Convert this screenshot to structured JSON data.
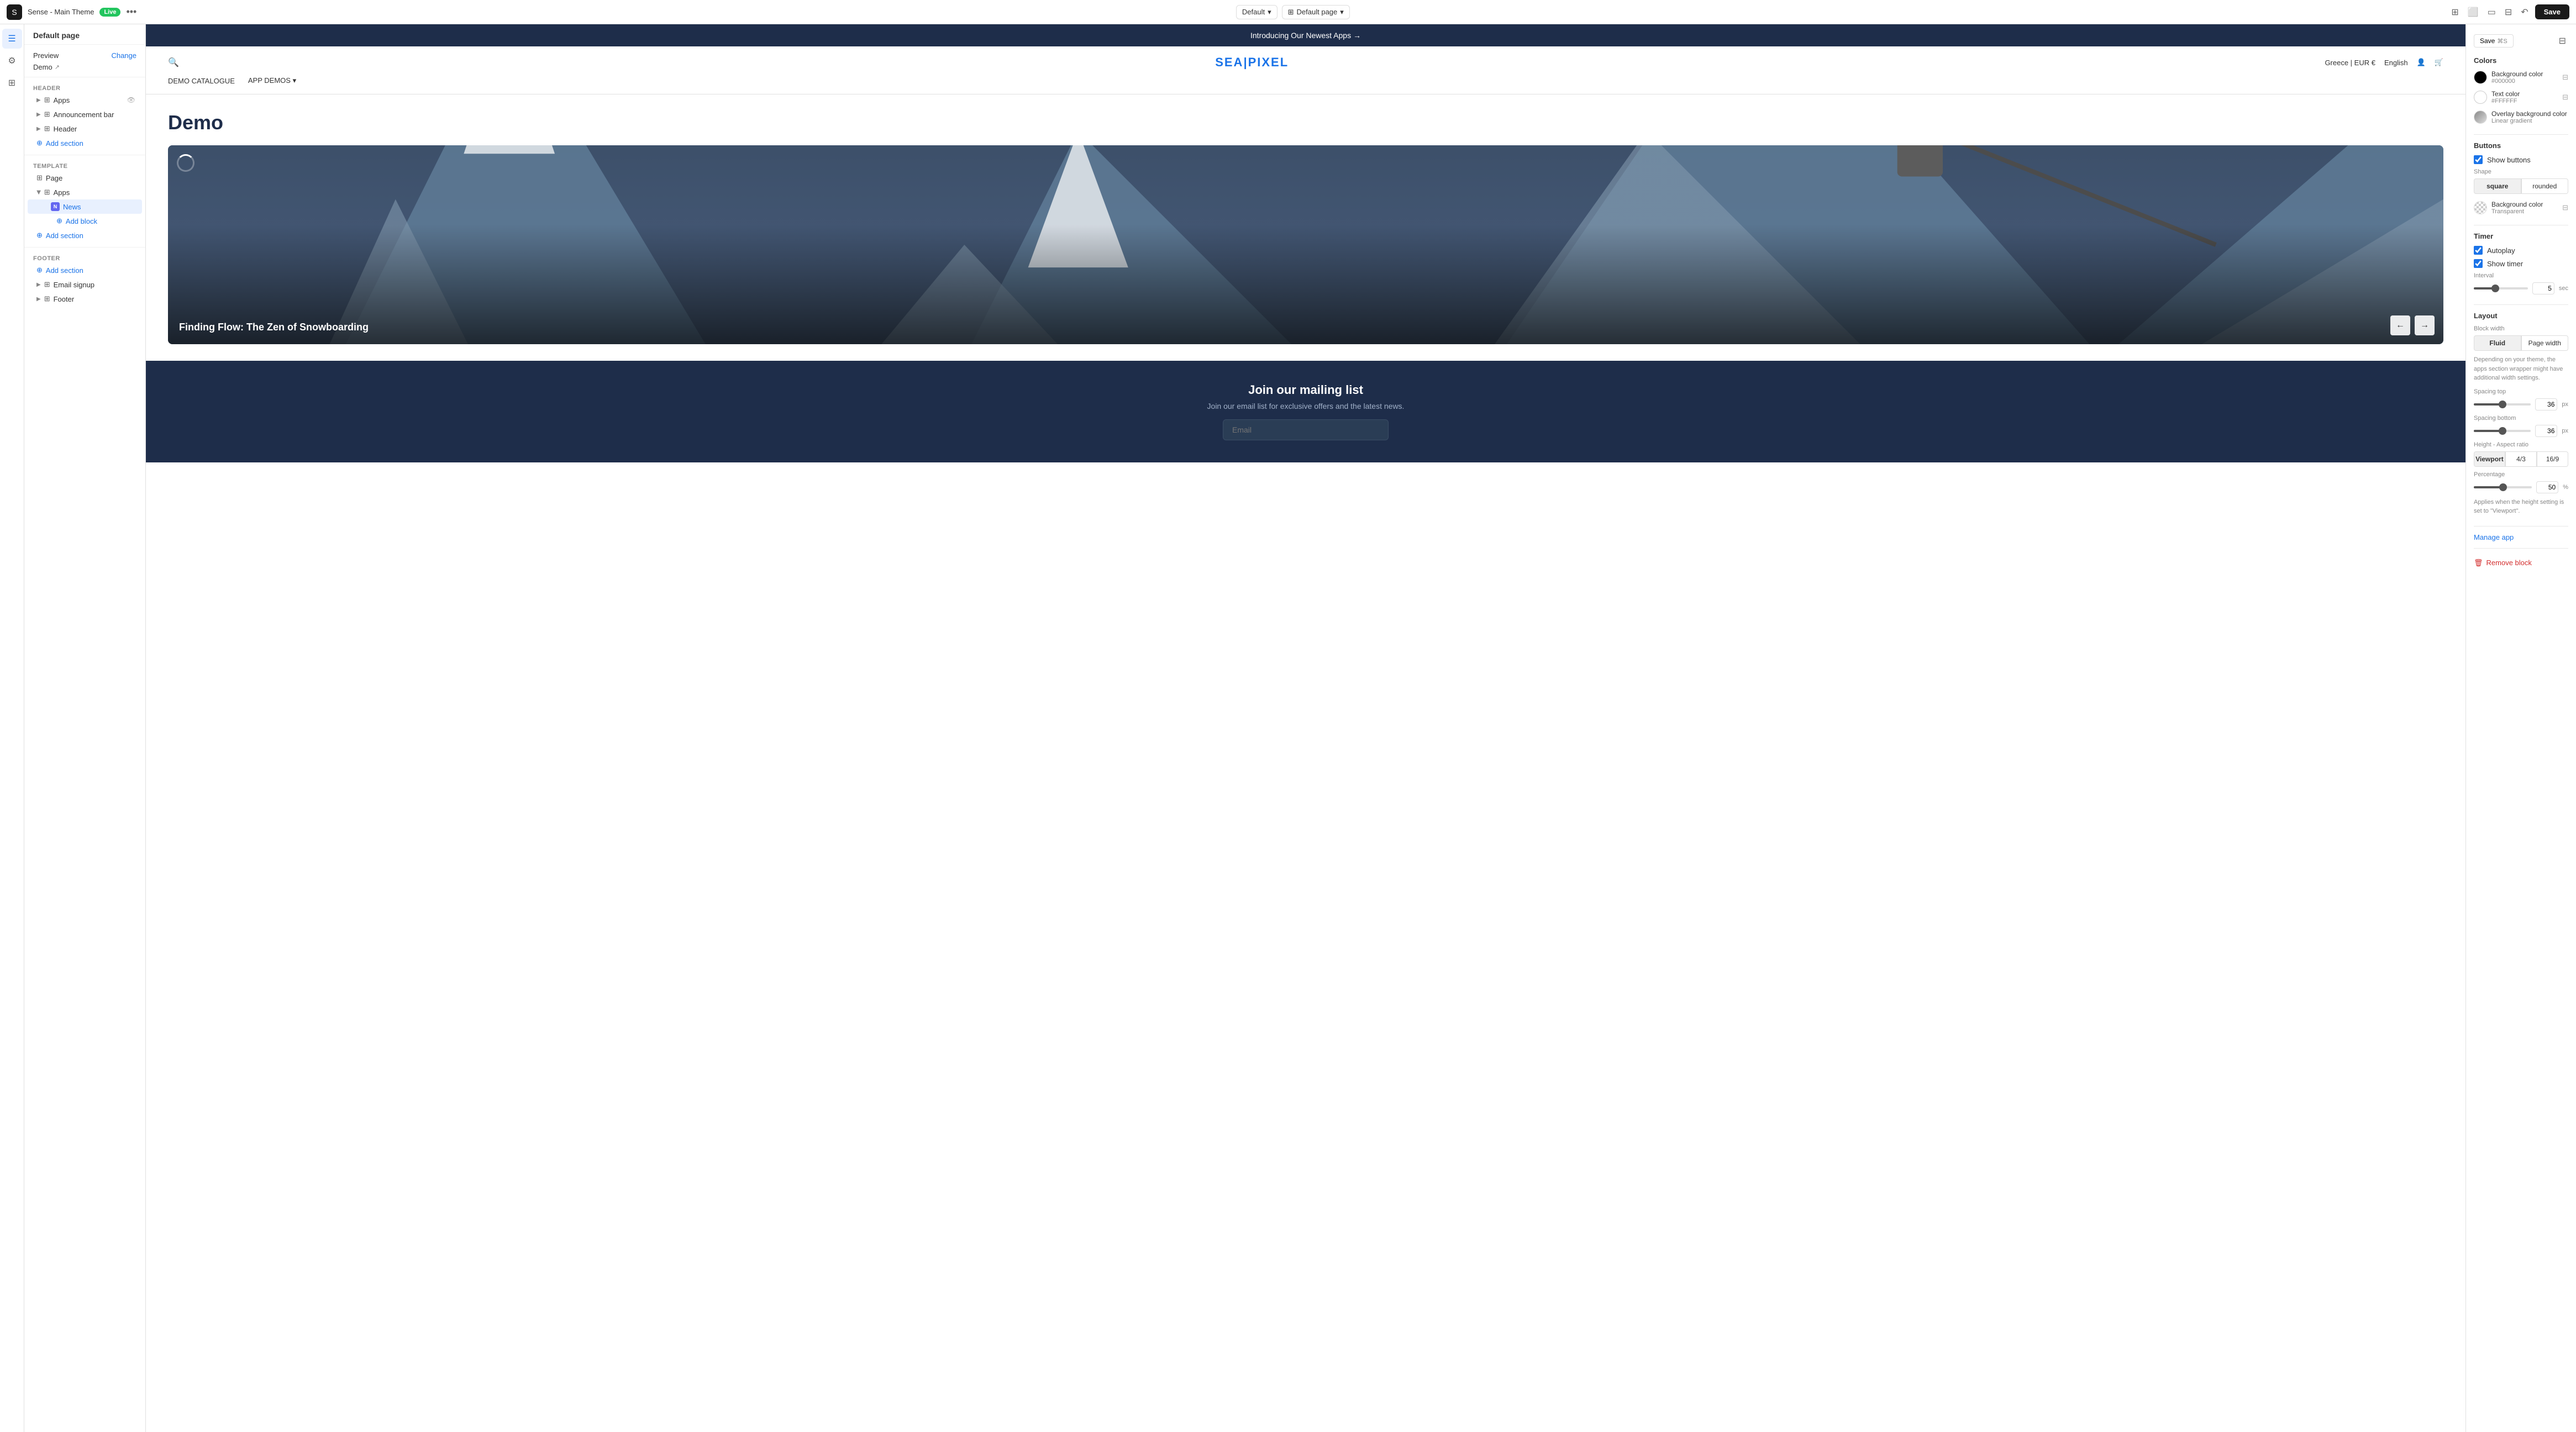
{
  "topbar": {
    "theme_name": "Sense - Main Theme",
    "live_label": "Live",
    "more_icon": "•••",
    "default_label": "Default",
    "default_page_label": "Default page",
    "save_label": "Save",
    "save_shortcut": "⌘S"
  },
  "left_panel": {
    "title": "Default page",
    "preview_label": "Preview",
    "change_label": "Change",
    "demo_label": "Demo",
    "header_section": "Header",
    "header_items": [
      {
        "id": "apps",
        "label": "Apps",
        "has_eye": true
      },
      {
        "id": "announcement-bar",
        "label": "Announcement bar"
      },
      {
        "id": "header",
        "label": "Header"
      }
    ],
    "add_section_label": "Add section",
    "template_section": "Template",
    "template_items": [
      {
        "id": "page",
        "label": "Page"
      }
    ],
    "apps_group": "Apps",
    "news_item": "News",
    "add_block_label": "Add block",
    "footer_section": "Footer",
    "footer_add_section": "Add section",
    "footer_items": [
      {
        "id": "email-signup",
        "label": "Email signup"
      },
      {
        "id": "footer",
        "label": "Footer"
      }
    ]
  },
  "canvas": {
    "announcement_text": "Introducing Our Newest Apps →",
    "logo_part1": "SEA",
    "logo_sep": "",
    "logo_part2": "PIXEL",
    "locale": "Greece | EUR €",
    "language": "English",
    "nav_items": [
      "DEMO CATALOGUE",
      "APP DEMOS"
    ],
    "page_title": "Demo",
    "slider_caption": "Finding Flow: The Zen of Snowboarding",
    "loader_visible": true,
    "prev_icon": "←",
    "next_icon": "→",
    "footer_heading": "Join our mailing list",
    "footer_sub": "Join our email list for exclusive offers and the latest news.",
    "email_placeholder": "Email"
  },
  "right_panel": {
    "save_label": "Save",
    "save_shortcut": "⌘S",
    "colors_section": "Colors",
    "bg_color_label": "Background color",
    "bg_color_value": "#000000",
    "text_color_label": "Text color",
    "text_color_value": "#FFFFFF",
    "overlay_bg_label": "Overlay background color",
    "overlay_bg_value": "Linear gradient",
    "buttons_section": "Buttons",
    "show_buttons_label": "Show buttons",
    "shape_section": "Shape",
    "shape_square": "square",
    "shape_rounded": "rounded",
    "btn_bg_color_label": "Background color",
    "btn_bg_color_value": "Transparent",
    "timer_section": "Timer",
    "autoplay_label": "Autoplay",
    "show_timer_label": "Show timer",
    "interval_label": "Interval",
    "interval_value": "5",
    "interval_unit": "sec",
    "layout_section": "Layout",
    "block_width_label": "Block width",
    "fluid_label": "Fluid",
    "page_width_label": "Page width",
    "description": "Depending on your theme, the apps section wrapper might have additional width settings.",
    "spacing_top_label": "Spacing top",
    "spacing_top_value": "36",
    "spacing_top_unit": "px",
    "spacing_bottom_label": "Spacing bottom",
    "spacing_bottom_value": "36",
    "spacing_bottom_unit": "px",
    "height_label": "Height - Aspect ratio",
    "viewport_label": "Viewport",
    "ratio_4_3": "4/3",
    "ratio_16_9": "16/9",
    "percentage_label": "Percentage",
    "percentage_value": "50",
    "percentage_unit": "%",
    "percentage_desc": "Applies when the height setting is set to \"Viewport\".",
    "manage_app_label": "Manage app",
    "remove_block_label": "Remove block"
  }
}
